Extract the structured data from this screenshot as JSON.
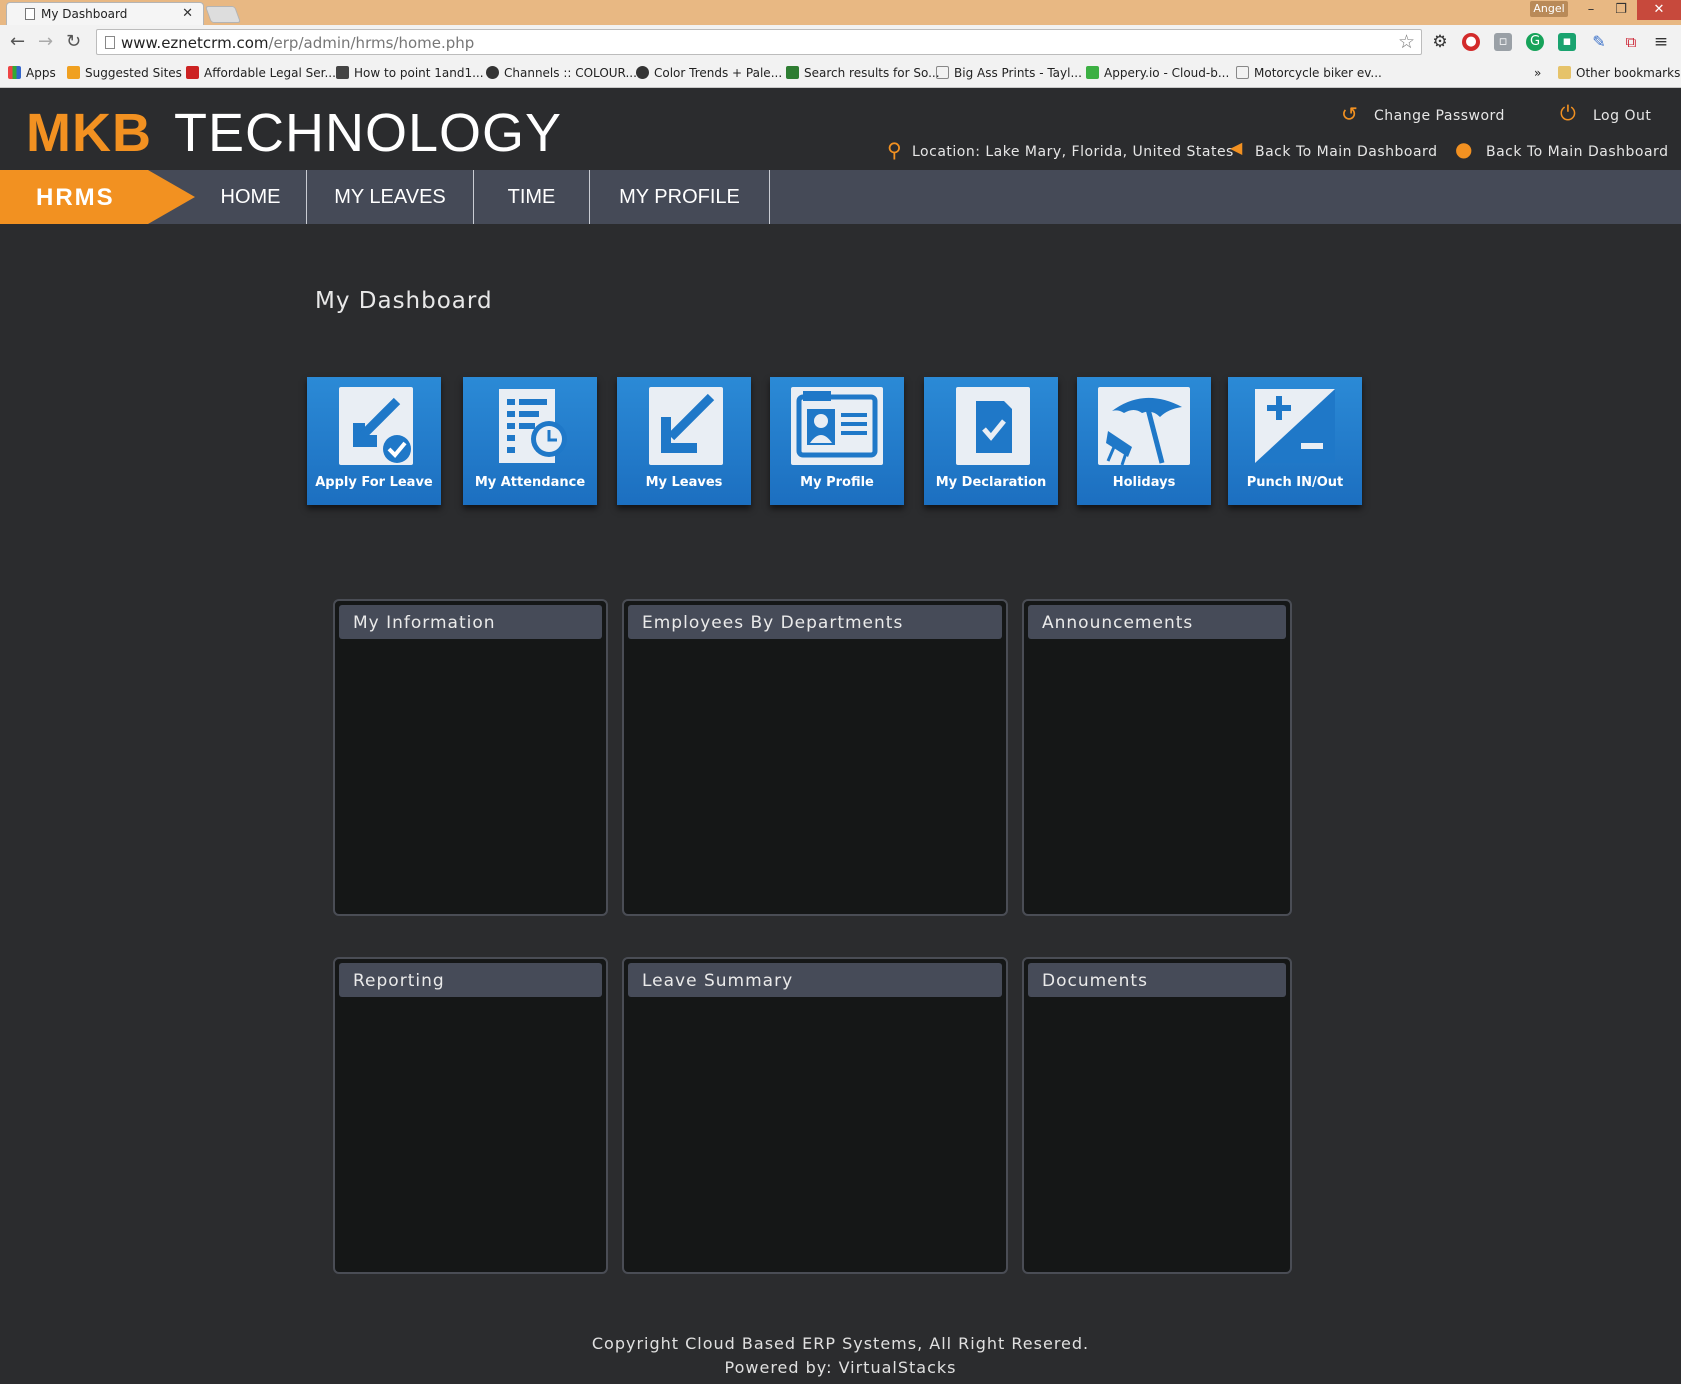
{
  "browser": {
    "tab_title": "My Dashboard",
    "user": "Angel",
    "url_host": "www.eznetcrm.com",
    "url_path": "/erp/admin/hrms/home.php",
    "bookmarks": [
      "Apps",
      "Suggested Sites",
      "Affordable Legal Ser...",
      "How to point 1and1...",
      "Channels :: COLOUR...",
      "Color Trends + Pale...",
      "Search results for So...",
      "Big Ass Prints - Tayl...",
      "Appery.io - Cloud-b...",
      "Motorcycle biker ev..."
    ],
    "overflow": "»",
    "other_bookmarks": "Other bookmarks"
  },
  "header": {
    "brand_primary": "MKB",
    "brand_secondary": "TECHNOLOGY",
    "change_password": "Change Password",
    "log_out": "Log Out",
    "location": "Location: Lake Mary, Florida, United States",
    "back_main_1": "Back To Main Dashboard",
    "back_main_2": "Back To Main Dashboard"
  },
  "nav": {
    "module": "HRMS",
    "items": [
      "HOME",
      "MY LEAVES",
      "TIME",
      "MY PROFILE"
    ]
  },
  "main": {
    "title": "My Dashboard",
    "tiles": [
      {
        "label": "Apply For Leave",
        "icon": "apply-leave-icon"
      },
      {
        "label": "My Attendance",
        "icon": "attendance-icon"
      },
      {
        "label": "My Leaves",
        "icon": "leaves-icon"
      },
      {
        "label": "My Profile",
        "icon": "profile-card-icon"
      },
      {
        "label": "My Declaration",
        "icon": "declaration-icon"
      },
      {
        "label": "Holidays",
        "icon": "beach-umbrella-icon"
      },
      {
        "label": "Punch IN/Out",
        "icon": "plus-minus-icon"
      }
    ],
    "panels": [
      "My Information",
      "Employees By Departments",
      "Announcements",
      "Reporting",
      "Leave Summary",
      "Documents"
    ]
  },
  "footer": {
    "copyright": "Copyright Cloud Based ERP Systems, All Right Resered.",
    "powered": "Powered by: VirtualStacks"
  },
  "colors": {
    "accent": "#f29121",
    "background": "#2b2c2e",
    "nav": "#454a57",
    "tile": "#1f78c8"
  }
}
